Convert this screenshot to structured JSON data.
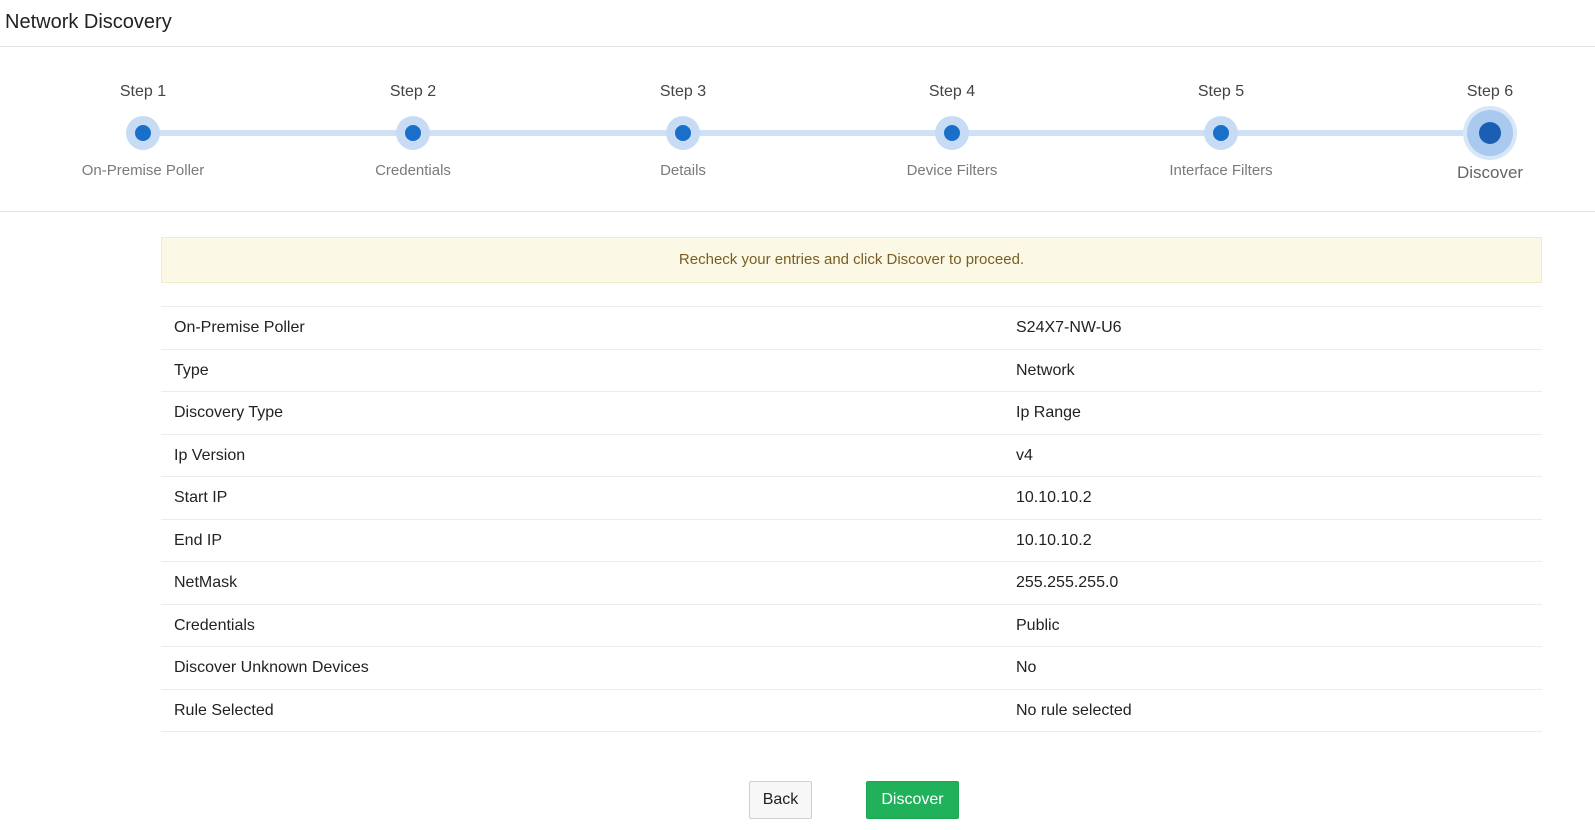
{
  "header": {
    "title": "Network Discovery"
  },
  "steps": [
    {
      "number": "Step 1",
      "label": "On-Premise Poller"
    },
    {
      "number": "Step 2",
      "label": "Credentials"
    },
    {
      "number": "Step 3",
      "label": "Details"
    },
    {
      "number": "Step 4",
      "label": "Device Filters"
    },
    {
      "number": "Step 5",
      "label": "Interface Filters"
    },
    {
      "number": "Step 6",
      "label": "Discover"
    }
  ],
  "active_step": 6,
  "notice": {
    "text": "Recheck your entries and click Discover to proceed."
  },
  "summary": [
    {
      "key": "On-Premise Poller",
      "value": "S24X7-NW-U6"
    },
    {
      "key": "Type",
      "value": "Network"
    },
    {
      "key": "Discovery Type",
      "value": "Ip Range"
    },
    {
      "key": "Ip Version",
      "value": "v4"
    },
    {
      "key": "Start IP",
      "value": "10.10.10.2"
    },
    {
      "key": "End IP",
      "value": "10.10.10.2"
    },
    {
      "key": "NetMask",
      "value": "255.255.255.0"
    },
    {
      "key": "Credentials",
      "value": "Public"
    },
    {
      "key": "Discover Unknown Devices",
      "value": "No"
    },
    {
      "key": "Rule Selected",
      "value": "No rule selected"
    }
  ],
  "buttons": {
    "back_label": "Back",
    "discover_label": "Discover"
  },
  "colors": {
    "step_accent": "#1a6fc9",
    "track": "#cfe1f6",
    "notice_bg": "#fbf8e6",
    "notice_text": "#7a5f24",
    "primary_button": "#21b15a"
  }
}
